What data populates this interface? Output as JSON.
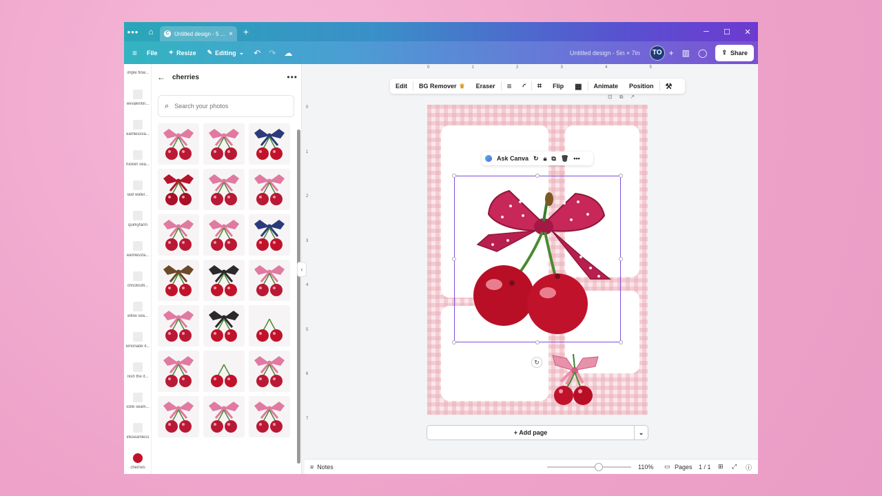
{
  "tabbar": {
    "dots_icon": "more-dots-icon",
    "home_icon": "home-icon",
    "tab_label": "Untitled design - 5 ...",
    "tab_icon_letter": "C",
    "tab_close": "×",
    "new_tab": "+",
    "minimize": "─",
    "maximize": "☐",
    "close": "✕"
  },
  "toolbar": {
    "menu_icon": "≡",
    "file": "File",
    "resize": "Resize",
    "editing": "Editing",
    "design_title": "Untitled design - 5in × 7in",
    "avatar": "TO",
    "plus": "+",
    "share": "Share"
  },
  "strip": [
    {
      "label": "imple flow..."
    },
    {
      "label": "eevalentin..."
    },
    {
      "label": "eamlessva..."
    },
    {
      "label": "hicken sea..."
    },
    {
      "label": "laid water..."
    },
    {
      "label": "quirkyfarm"
    },
    {
      "label": "eamlessfa..."
    },
    {
      "label": "chooloutli..."
    },
    {
      "label": "ellow sea..."
    },
    {
      "label": "emonade it..."
    },
    {
      "label": "nish the it..."
    },
    {
      "label": "ickle seam..."
    },
    {
      "label": "inkseamless"
    },
    {
      "label": "cherries"
    }
  ],
  "panel": {
    "title": "cherries",
    "search_placeholder": "Search your photos"
  },
  "photos": [
    {
      "kind": "pinkbow"
    },
    {
      "kind": "pinkbow"
    },
    {
      "kind": "navybow"
    },
    {
      "kind": "redbow"
    },
    {
      "kind": "pinkbow"
    },
    {
      "kind": "pinkbow"
    },
    {
      "kind": "pinkbow"
    },
    {
      "kind": "pinkbow"
    },
    {
      "kind": "navybow"
    },
    {
      "kind": "leopardbow"
    },
    {
      "kind": "plaidbow"
    },
    {
      "kind": "pinkbow"
    },
    {
      "kind": "pinkbow"
    },
    {
      "kind": "plaidbow"
    },
    {
      "kind": "nobow"
    },
    {
      "kind": "pinkbow"
    },
    {
      "kind": "nobow"
    },
    {
      "kind": "pinkbow"
    },
    {
      "kind": "pinkbow"
    },
    {
      "kind": "pinkbow"
    },
    {
      "kind": "pinkbow"
    }
  ],
  "ruler": {
    "h": [
      "0",
      "1",
      "2",
      "3",
      "4",
      "5"
    ],
    "v": [
      "0",
      "1",
      "2",
      "3",
      "4",
      "5",
      "6",
      "7"
    ]
  },
  "context_toolbar": {
    "edit": "Edit",
    "bg_remover": "BG Remover",
    "eraser": "Eraser",
    "flip": "Flip",
    "animate": "Animate",
    "position": "Position"
  },
  "ask_bar": {
    "ask": "Ask Canva"
  },
  "add_page": "+ Add page",
  "footer": {
    "notes": "Notes",
    "zoom_percent": 110,
    "zoom": "110%",
    "pages": "Pages",
    "page_count": "1 / 1"
  },
  "colors": {
    "accent": "#7c4ddc",
    "cherry": "#c0132b",
    "bow_pink": "#d8497a"
  }
}
